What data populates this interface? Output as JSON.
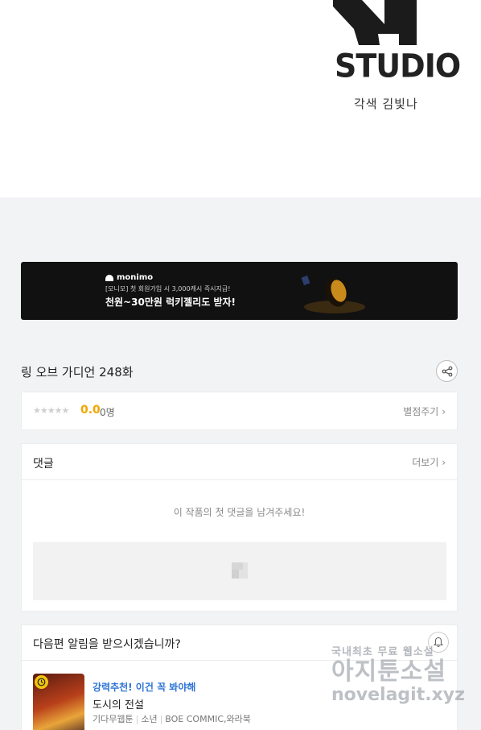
{
  "studio": {
    "wordmark": "STUDIO",
    "credit": "각색 김빛나"
  },
  "ad": {
    "brand": "monimo",
    "subtitle": "[모니모] 첫 회원가입 시 3,000캐시 즉시지급!",
    "headline": "천원~30만원 럭키젤리도 받자!"
  },
  "episode": {
    "title": "링 오브 가디언 248화"
  },
  "rating": {
    "stars_display": "★★★★★",
    "score": "0.0",
    "voters": "0명",
    "rate_label": "별점주기",
    "rate_chevron": "›",
    "value": 0.0
  },
  "comments": {
    "title": "댓글",
    "more_label": "더보기",
    "more_chevron": "›",
    "empty_message": "이 작품의 첫 댓글을 남겨주세요!"
  },
  "notify": {
    "question": "다음편 알림을 받으시겠습니까?"
  },
  "recommendation": {
    "tag": "강력추천! 이건 꼭 봐야해",
    "title": "도시의 전설",
    "meta": [
      "기다무웹툰",
      "소년",
      "BOE COMMIC,와라북"
    ]
  },
  "watermark": {
    "line1": "국내최초 무료 웹소설",
    "line2": "아지툰소설",
    "line3": "novelagit.xyz"
  },
  "icons": {
    "share": "share-icon",
    "bell": "bell-icon",
    "clock": "clock-badge-icon",
    "image_placeholder": "image-placeholder-icon"
  },
  "colors": {
    "score": "#f0a600",
    "rec_tag": "#2e74d6",
    "ad_background": "#111111",
    "page_background": "#f2f3f5"
  }
}
